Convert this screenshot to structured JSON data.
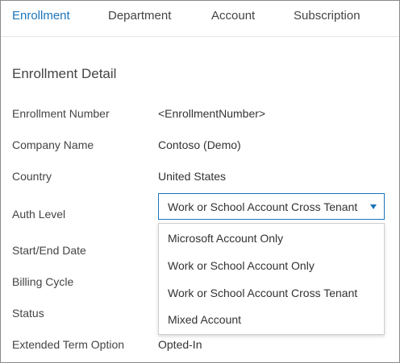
{
  "tabs": [
    {
      "label": "Enrollment",
      "active": true
    },
    {
      "label": "Department",
      "active": false
    },
    {
      "label": "Account",
      "active": false
    },
    {
      "label": "Subscription",
      "active": false
    }
  ],
  "section_title": "Enrollment Detail",
  "fields": {
    "enrollment_number": {
      "label": "Enrollment Number",
      "value": "<EnrollmentNumber>"
    },
    "company_name": {
      "label": "Company Name",
      "value": "Contoso (Demo)"
    },
    "country": {
      "label": "Country",
      "value": "United States"
    },
    "auth_level": {
      "label": "Auth Level",
      "value": "Work or School Account Cross Tenant"
    },
    "start_end_date": {
      "label": "Start/End Date"
    },
    "billing_cycle": {
      "label": "Billing Cycle"
    },
    "status": {
      "label": "Status"
    },
    "extended_term_option": {
      "label": "Extended Term Option",
      "value": "Opted-In"
    }
  },
  "auth_options": [
    "Microsoft Account Only",
    "Work or School Account Only",
    "Work or School Account Cross Tenant",
    "Mixed Account"
  ],
  "colors": {
    "accent": "#1b75bb",
    "text": "#333333",
    "border": "#8a8a8a"
  },
  "icons": {
    "caret": "caret-down-icon"
  }
}
